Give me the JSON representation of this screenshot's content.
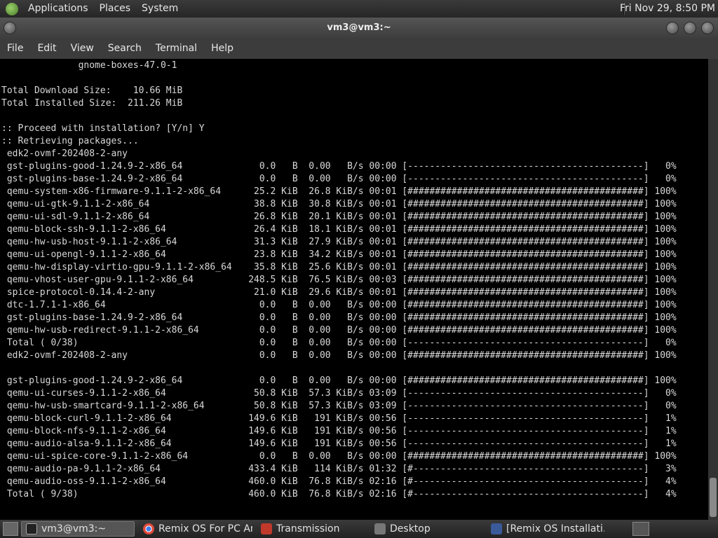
{
  "top_panel": {
    "menus": [
      "Applications",
      "Places",
      "System"
    ],
    "clock": "Fri Nov 29,  8:50 PM"
  },
  "window": {
    "title": "vm3@vm3:~"
  },
  "menubar": [
    "File",
    "Edit",
    "View",
    "Search",
    "Terminal",
    "Help"
  ],
  "terminal": {
    "lines": [
      "              gnome-boxes-47.0-1",
      "",
      "Total Download Size:    10.66 MiB",
      "Total Installed Size:  211.26 MiB",
      "",
      ":: Proceed with installation? [Y/n] Y",
      ":: Retrieving packages...",
      " edk2-ovmf-202408-2-any",
      " gst-plugins-good-1.24.9-2-x86_64              0.0   B  0.00   B/s 00:00 [-------------------------------------------]   0%",
      " gst-plugins-base-1.24.9-2-x86_64              0.0   B  0.00   B/s 00:00 [-------------------------------------------]   0%",
      " qemu-system-x86-firmware-9.1.1-2-x86_64      25.2 KiB  26.8 KiB/s 00:01 [###########################################] 100%",
      " qemu-ui-gtk-9.1.1-2-x86_64                   38.8 KiB  30.8 KiB/s 00:01 [###########################################] 100%",
      " qemu-ui-sdl-9.1.1-2-x86_64                   26.8 KiB  20.1 KiB/s 00:01 [###########################################] 100%",
      " qemu-block-ssh-9.1.1-2-x86_64                26.4 KiB  18.1 KiB/s 00:01 [###########################################] 100%",
      " qemu-hw-usb-host-9.1.1-2-x86_64              31.3 KiB  27.9 KiB/s 00:01 [###########################################] 100%",
      " qemu-ui-opengl-9.1.1-2-x86_64                23.8 KiB  34.2 KiB/s 00:01 [###########################################] 100%",
      " qemu-hw-display-virtio-gpu-9.1.1-2-x86_64    35.8 KiB  25.6 KiB/s 00:01 [###########################################] 100%",
      " qemu-vhost-user-gpu-9.1.1-2-x86_64          248.5 KiB  76.5 KiB/s 00:03 [###########################################] 100%",
      " spice-protocol-0.14.4-2-any                  21.0 KiB  29.6 KiB/s 00:01 [###########################################] 100%",
      " dtc-1.7.1-1-x86_64                            0.0   B  0.00   B/s 00:00 [###########################################] 100%",
      " gst-plugins-base-1.24.9-2-x86_64              0.0   B  0.00   B/s 00:00 [###########################################] 100%",
      " qemu-hw-usb-redirect-9.1.1-2-x86_64           0.0   B  0.00   B/s 00:00 [###########################################] 100%",
      " Total ( 0/38)                                 0.0   B  0.00   B/s 00:00 [-------------------------------------------]   0%",
      " edk2-ovmf-202408-2-any                        0.0   B  0.00   B/s 00:00 [###########################################] 100%",
      "",
      " gst-plugins-good-1.24.9-2-x86_64              0.0   B  0.00   B/s 00:00 [###########################################] 100%",
      " qemu-ui-curses-9.1.1-2-x86_64                50.8 KiB  57.3 KiB/s 03:09 [-------------------------------------------]   0%",
      " qemu-hw-usb-smartcard-9.1.1-2-x86_64         50.8 KiB  57.3 KiB/s 03:09 [-------------------------------------------]   0%",
      " qemu-block-curl-9.1.1-2-x86_64              149.6 KiB   191 KiB/s 00:56 [-------------------------------------------]   1%",
      " qemu-block-nfs-9.1.1-2-x86_64               149.6 KiB   191 KiB/s 00:56 [-------------------------------------------]   1%",
      " qemu-audio-alsa-9.1.1-2-x86_64              149.6 KiB   191 KiB/s 00:56 [-------------------------------------------]   1%",
      " qemu-ui-spice-core-9.1.1-2-x86_64             0.0   B  0.00   B/s 00:00 [###########################################] 100%",
      " qemu-audio-pa-9.1.1-2-x86_64                433.4 KiB   114 KiB/s 01:32 [#------------------------------------------]   3%",
      " qemu-audio-oss-9.1.1-2-x86_64               460.0 KiB  76.8 KiB/s 02:16 [#------------------------------------------]   4%",
      " Total ( 9/38)                               460.0 KiB  76.8 KiB/s 02:16 [#------------------------------------------]   4%"
    ]
  },
  "taskbar": {
    "tasks": [
      {
        "label": "vm3@vm3:~",
        "icon": "terminal-icon"
      },
      {
        "label": "Remix OS For PC An...",
        "icon": "chrome-icon"
      },
      {
        "label": "Transmission",
        "icon": "transmission-icon"
      },
      {
        "label": "Desktop",
        "icon": "folder-icon"
      },
      {
        "label": "[Remix OS Installati...",
        "icon": "remix-icon"
      }
    ]
  }
}
